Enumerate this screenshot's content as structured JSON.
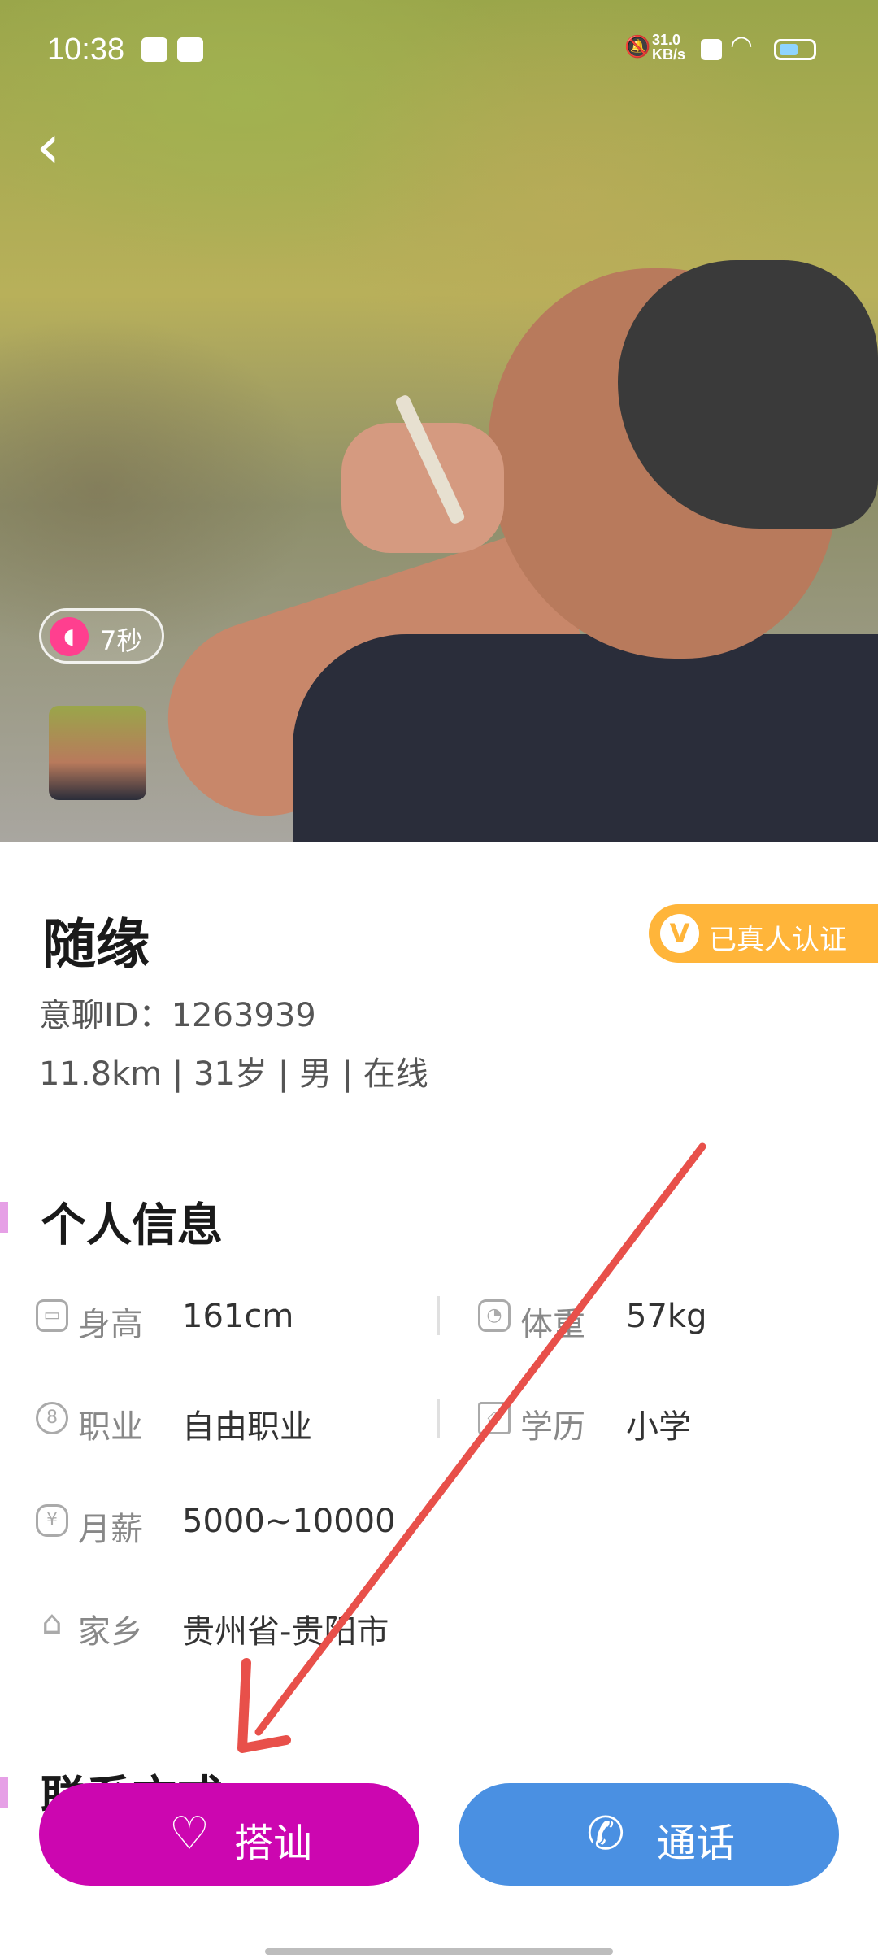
{
  "status_bar": {
    "time": "10:38",
    "net_speed": "31.0\nKB/s"
  },
  "profile": {
    "name": "随缘",
    "verified_badge": "已真人认证",
    "verified_icon": "V",
    "id_line": "意聊ID：1263939",
    "info_line": "11.8km | 31岁 | 男 | 在线",
    "voice_duration": "7秒"
  },
  "personal_info": {
    "title": "个人信息",
    "items": [
      {
        "label": "身高",
        "value": "161cm",
        "icon": "ruler-icon"
      },
      {
        "label": "体重",
        "value": "57kg",
        "icon": "scale-icon"
      },
      {
        "label": "职业",
        "value": "自由职业",
        "icon": "badge-icon"
      },
      {
        "label": "学历",
        "value": "小学",
        "icon": "graduation-cap-icon"
      },
      {
        "label": "月薪",
        "value": "5000~10000",
        "icon": "money-bag-icon"
      },
      {
        "label": "家乡",
        "value": "贵州省-贵阳市",
        "icon": "home-icon"
      }
    ]
  },
  "contact": {
    "title": "联系方式"
  },
  "actions": {
    "chat_label": "搭讪",
    "call_label": "通话"
  },
  "colors": {
    "chat_button": "#cc06b0",
    "call_button": "#4a90e2",
    "verified_badge": "#ffb53a",
    "annotation_arrow": "#e8504a"
  }
}
